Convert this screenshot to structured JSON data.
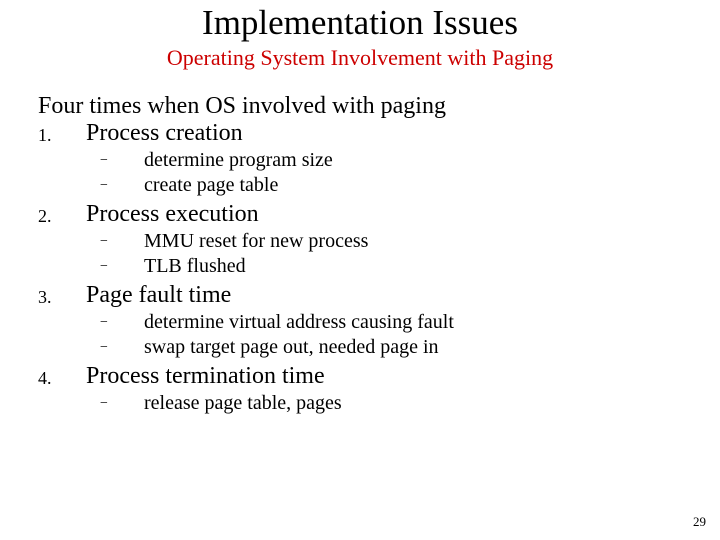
{
  "title": "Implementation Issues",
  "subtitle": "Operating System Involvement with Paging",
  "lead": "Four times when OS involved with paging",
  "items": {
    "i1": {
      "num": "1.",
      "text": "Process creation"
    },
    "i1s1": "determine program size",
    "i1s2": "create page table",
    "i2": {
      "num": "2.",
      "text": "Process execution"
    },
    "i2s1": "MMU reset for new process",
    "i2s2": "TLB flushed",
    "i3": {
      "num": "3.",
      "text": "Page fault time"
    },
    "i3s1": "determine virtual address causing fault",
    "i3s2": "swap target page out, needed page in",
    "i4": {
      "num": "4.",
      "text": "Process termination time"
    },
    "i4s1": "release page table, pages"
  },
  "dash": "−",
  "page_number": "29"
}
